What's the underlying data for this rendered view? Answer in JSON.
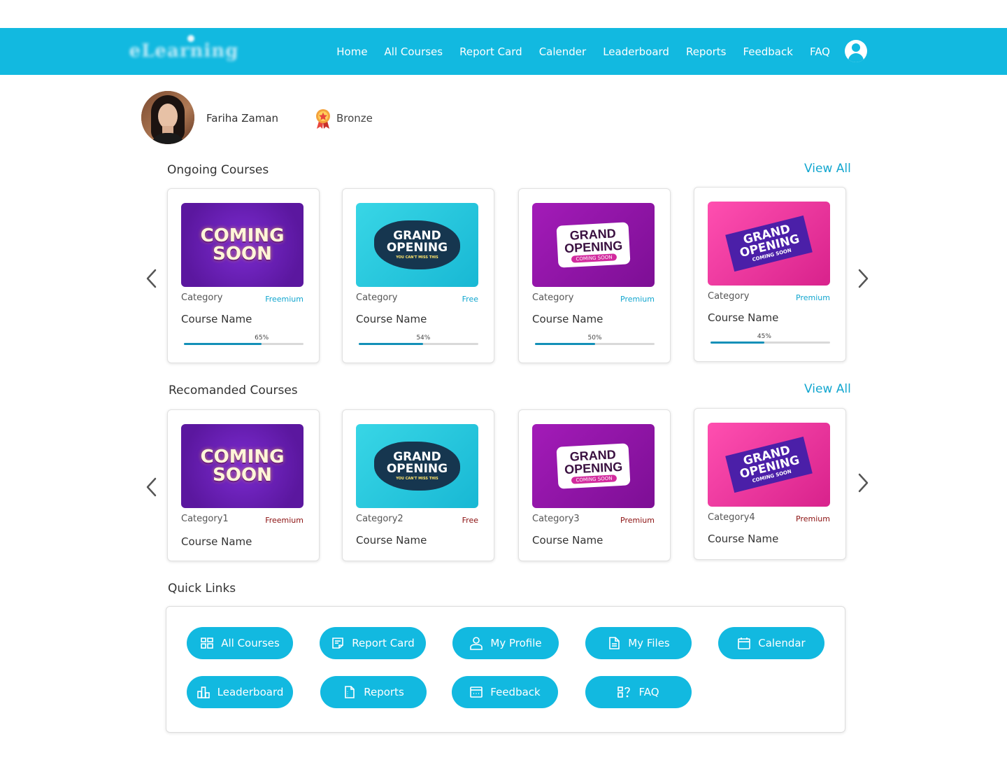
{
  "header": {
    "logo_text": "eLearning",
    "nav": [
      "Home",
      "All Courses",
      "Report Card",
      "Calender",
      "Leaderboard",
      "Reports",
      "Feedback",
      "FAQ"
    ]
  },
  "profile": {
    "name": "Fariha Zaman",
    "badge": "Bronze"
  },
  "ongoing": {
    "title": "Ongoing Courses",
    "view_all": "View All",
    "courses": [
      {
        "category": "Category",
        "tier": "Freemium",
        "name": "Course Name",
        "progress": "65%",
        "progress_value": 65,
        "thumb": "COMING SOON"
      },
      {
        "category": "Category",
        "tier": "Free",
        "name": "Course Name",
        "progress": "54%",
        "progress_value": 54,
        "thumb": "GRAND OPENING"
      },
      {
        "category": "Category",
        "tier": "Premium",
        "name": "Course Name",
        "progress": "50%",
        "progress_value": 50,
        "thumb": "GRAND OPENING"
      },
      {
        "category": "Category",
        "tier": "Premium",
        "name": "Course Name",
        "progress": "45%",
        "progress_value": 45,
        "thumb": "GRAND OPENING"
      }
    ]
  },
  "recommended": {
    "title": "Recomanded Courses",
    "view_all": "View All",
    "courses": [
      {
        "category": "Category1",
        "tier": "Freemium",
        "name": "Course Name",
        "thumb": "COMING SOON"
      },
      {
        "category": "Category2",
        "tier": "Free",
        "name": "Course Name",
        "thumb": "GRAND OPENING"
      },
      {
        "category": "Category3",
        "tier": "Premium",
        "name": "Course Name",
        "thumb": "GRAND OPENING"
      },
      {
        "category": "Category4",
        "tier": "Premium",
        "name": "Course Name",
        "thumb": "GRAND OPENING"
      }
    ]
  },
  "thumb_text": {
    "coming_1": "COMING",
    "coming_2": "SOON",
    "grand": "GRAND",
    "opening": "OPENING",
    "coming_soon_small": "COMING SOON",
    "you_cant_miss": "YOU CAN'T MISS THIS"
  },
  "quick_links": {
    "title": "Quick Links",
    "items": [
      {
        "label": "All Courses",
        "icon": "grid-icon"
      },
      {
        "label": "Report Card",
        "icon": "report-card-icon"
      },
      {
        "label": "My Profile",
        "icon": "user-icon"
      },
      {
        "label": "My Files",
        "icon": "file-icon"
      },
      {
        "label": "Calendar",
        "icon": "calendar-icon"
      },
      {
        "label": "Leaderboard",
        "icon": "leaderboard-icon"
      },
      {
        "label": "Reports",
        "icon": "reports-icon"
      },
      {
        "label": "Feedback",
        "icon": "feedback-icon"
      },
      {
        "label": "FAQ",
        "icon": "faq-icon"
      }
    ]
  },
  "colors": {
    "brand": "#12b9e0",
    "link": "#12a6cf",
    "progress": "#1390b8",
    "premium_recommended": "#8b1010"
  }
}
